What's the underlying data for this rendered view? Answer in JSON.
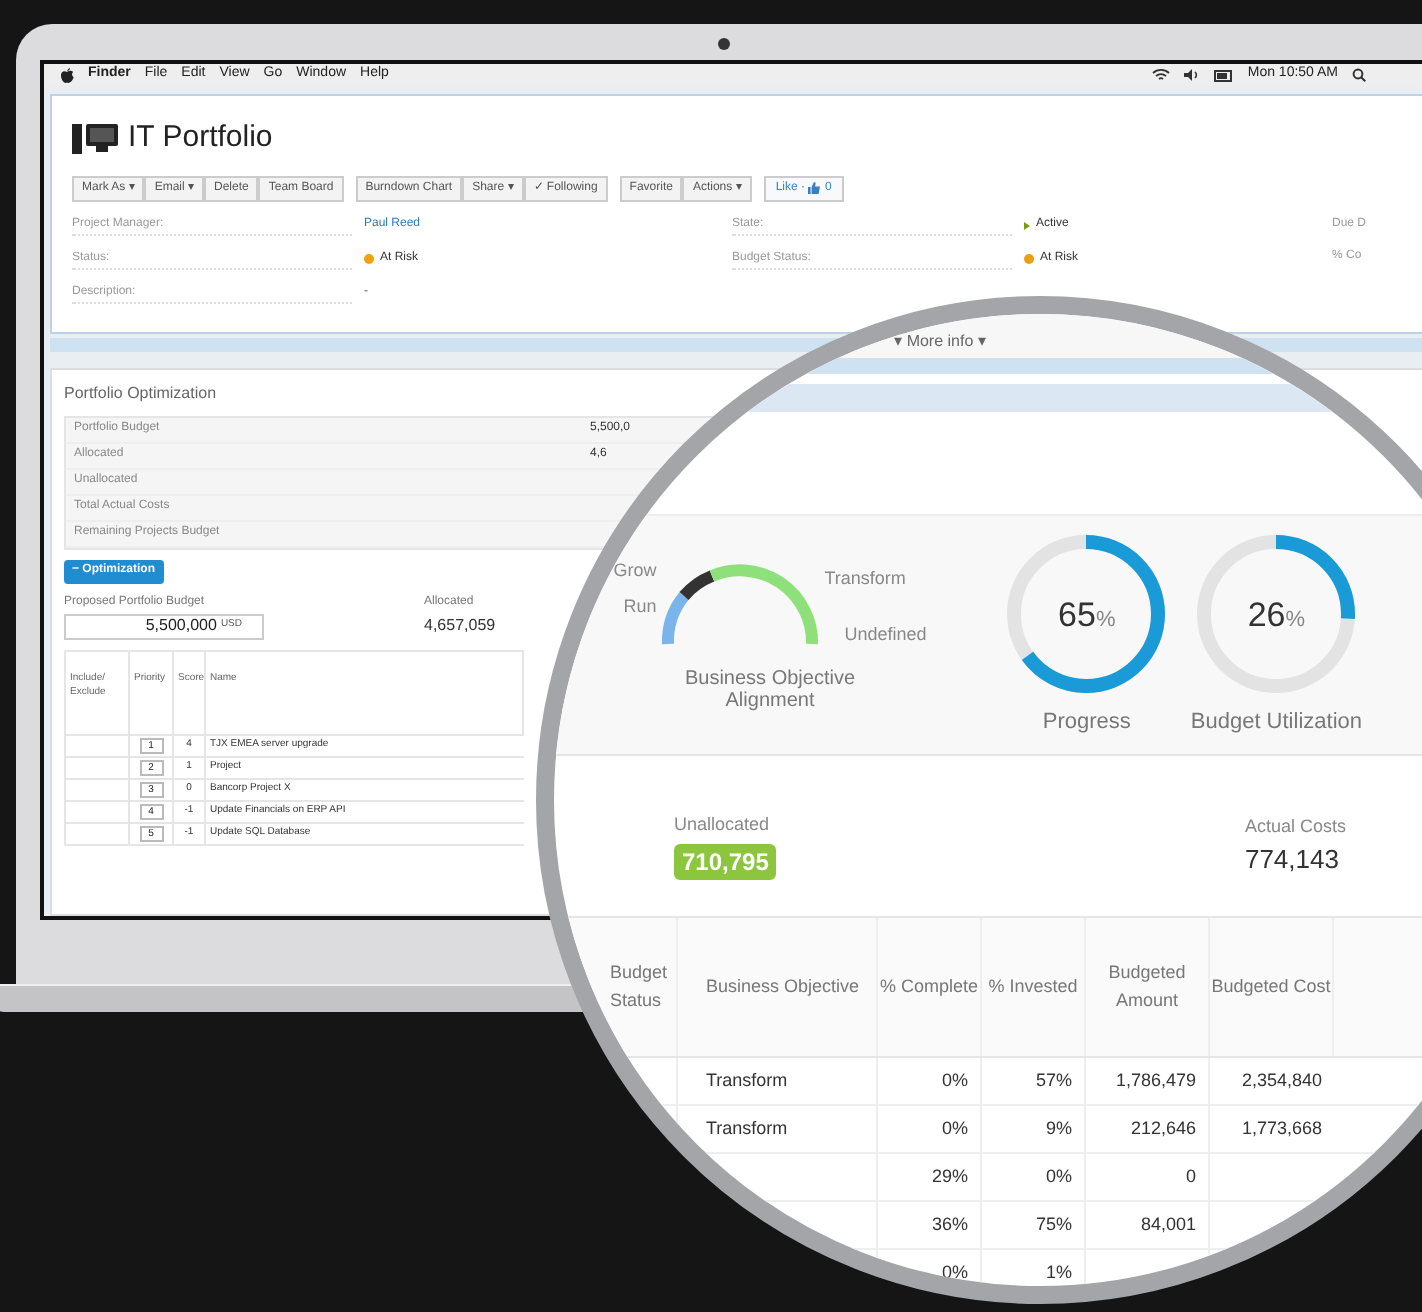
{
  "menu_bar": {
    "app": "Finder",
    "items": [
      "File",
      "Edit",
      "View",
      "Go",
      "Window",
      "Help"
    ],
    "clock": "Mon 10:50 AM"
  },
  "header": {
    "title": "IT Portfolio",
    "toolbar_groups": [
      [
        "Mark As ▾",
        "Email ▾",
        "Delete",
        "Team Board"
      ],
      [
        "Burndown Chart",
        "Share ▾",
        "✓ Following"
      ],
      [
        "Favorite",
        "Actions ▾"
      ]
    ],
    "like": {
      "label": "Like ·",
      "count": "0"
    },
    "fields_left": [
      {
        "label": "Project Manager:",
        "value": "Paul Reed",
        "kind": "link"
      },
      {
        "label": "Status:",
        "value": "At Risk",
        "kind": "status",
        "color": "#f0a30a"
      },
      {
        "label": "Description:",
        "value": "-",
        "kind": "text"
      }
    ],
    "fields_right": [
      {
        "label": "State:",
        "value": "Active",
        "kind": "state"
      },
      {
        "label": "Budget Status:",
        "value": "At Risk",
        "kind": "status",
        "color": "#e8a010"
      }
    ],
    "fields_cut": [
      "Due D",
      "% Co"
    ]
  },
  "portfolio_optimization": {
    "title": "Portfolio Optimization",
    "rows": [
      {
        "label": "Portfolio Budget",
        "value": "5,500,0"
      },
      {
        "label": "Allocated",
        "value": "4,6"
      },
      {
        "label": "Unallocated"
      },
      {
        "label": "Total Actual Costs"
      },
      {
        "label": "Remaining Projects Budget"
      }
    ],
    "toggle": "− Optimization",
    "proposed_label": "Proposed Portfolio Budget",
    "proposed_value": "5,500,000",
    "currency": "USD",
    "allocated_label": "Allocated",
    "allocated_value": "4,657,059",
    "table": {
      "columns": [
        "Include/ Exclude",
        "Priority",
        "Score",
        "Name"
      ],
      "rows": [
        {
          "priority": "1",
          "score": "4",
          "name": "TJX EMEA server upgrade"
        },
        {
          "priority": "2",
          "score": "1",
          "name": "Project"
        },
        {
          "priority": "3",
          "score": "0",
          "name": "Bancorp Project X"
        },
        {
          "priority": "4",
          "score": "-1",
          "name": "Update Financials on ERP API"
        },
        {
          "priority": "5",
          "score": "-1",
          "name": "Update SQL Database"
        }
      ]
    }
  },
  "magnifier": {
    "more_info": "▾ More info ▾",
    "alignment": {
      "labels": [
        "Grow",
        "Run",
        "Transform",
        "Undefined"
      ],
      "caption": "Business Objective Alignment"
    },
    "meters": [
      {
        "value": "65",
        "unit": "%",
        "caption": "Progress",
        "level": 0.65
      },
      {
        "value": "26",
        "unit": "%",
        "caption": "Budget Utilization",
        "level": 0.26
      }
    ],
    "unallocated": {
      "label": "Unallocated",
      "value": "710,795"
    },
    "actual_costs": {
      "label": "Actual Costs",
      "value": "774,143"
    },
    "table": {
      "columns": [
        "Budget Status",
        "Business Objective",
        "% Complete",
        "% Invested",
        "Budgeted Amount",
        "Budgeted Cost"
      ],
      "rows": [
        {
          "objective": "Transform",
          "complete": "0%",
          "invested": "57%",
          "amount": "1,786,479",
          "cost": "2,354,840"
        },
        {
          "objective": "Transform",
          "complete": "0%",
          "invested": "9%",
          "amount": "212,646",
          "cost": "1,773,668"
        },
        {
          "complete": "29%",
          "invested": "0%",
          "amount": "0"
        },
        {
          "complete": "36%",
          "invested": "75%",
          "amount": "84,001"
        },
        {
          "complete": "0%",
          "invested": "1%"
        }
      ]
    }
  }
}
